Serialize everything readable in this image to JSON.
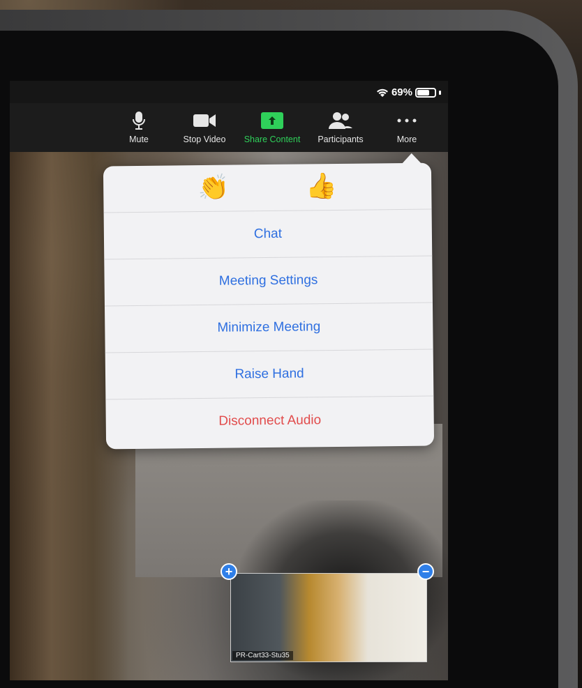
{
  "status_bar": {
    "battery_percent": "69%",
    "battery_level": 0.69
  },
  "toolbar": {
    "mute_label": "Mute",
    "stop_video_label": "Stop Video",
    "share_content_label": "Share Content",
    "participants_label": "Participants",
    "more_label": "More"
  },
  "menu": {
    "reactions": {
      "clap": "👏",
      "thumbs_up": "👍"
    },
    "items": [
      "Chat",
      "Meeting Settings",
      "Minimize Meeting",
      "Raise Hand",
      "Disconnect Audio"
    ]
  },
  "thumbnail": {
    "participant_name": "PR-Cart33-Stu35"
  },
  "colors": {
    "menu_blue": "#2e6fe0",
    "destructive_red": "#e14b4b",
    "share_green": "#2fd05a"
  }
}
